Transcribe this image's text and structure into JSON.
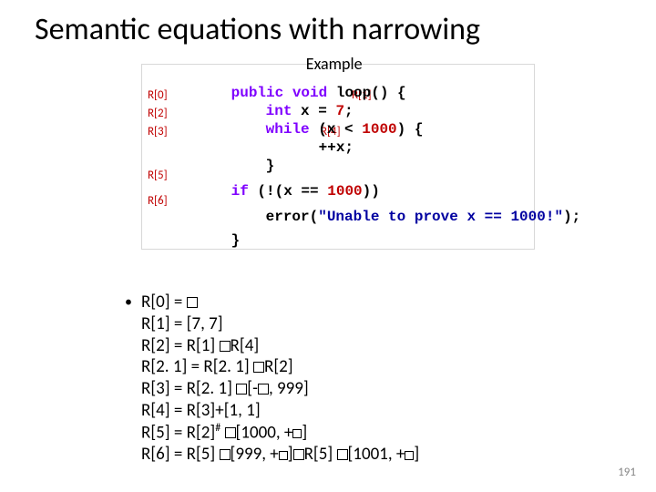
{
  "title": "Semantic equations with narrowing",
  "example_label": "Example",
  "rlabels": {
    "r0": "R[0]",
    "r1": "R[1]",
    "r2": "R[2]",
    "r3": "R[3]",
    "r4": "R[4]",
    "r5": "R[5]",
    "r6": "R[6]"
  },
  "code": {
    "kw_public": "public",
    "kw_void": "void",
    "fn_sig": " loop() {",
    "kw_int": "int",
    "decl": " x = ",
    "lit_7": "7",
    "semi": ";",
    "kw_while": "while",
    "while_cond": " (x < ",
    "lit_1000": "1000",
    "while_close": ") {",
    "inc": "++x;",
    "close_brace_1": "}",
    "kw_if": "if",
    "if_cond": " (!(x == ",
    "if_close": "))",
    "err_call": "error(",
    "err_str": "\"Unable to prove x == 1000!\"",
    "err_close": ");",
    "close_brace_2": "}"
  },
  "equations": {
    "e0_a": "R[0] = ",
    "e1": "R[1] = [7, 7]",
    "e2_a": "R[2] = R[1] ",
    "e2_b": "R[4]",
    "e21_a": "R[2. 1] = R[2. 1] ",
    "e21_b": "R[2]",
    "e3_a": "R[3] = R[2. 1] ",
    "e3_b": "[-",
    "e3_c": ", 999]",
    "e4": "R[4] = R[3]+[1, 1]",
    "e5_a": "R[5] = R[2]",
    "e5_hash": "#",
    "e5_b": "[1000, +",
    "e5_c": "]",
    "e6_a": "R[6] = R[5] ",
    "e6_b": "[999, +",
    "e6_c": "]",
    "e6_d": "R[5] ",
    "e6_e": "[1001, +",
    "e6_f": "]"
  },
  "pagenum": "191"
}
